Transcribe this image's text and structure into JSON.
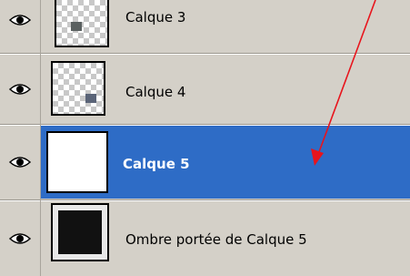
{
  "layers": [
    {
      "name": "Calque 3",
      "selected": false,
      "visible": true,
      "icon": "eye-icon"
    },
    {
      "name": "Calque 4",
      "selected": false,
      "visible": true,
      "icon": "eye-icon"
    },
    {
      "name": "Calque 5",
      "selected": true,
      "visible": true,
      "icon": "eye-icon"
    },
    {
      "name": "Ombre portée de Calque 5",
      "selected": false,
      "visible": true,
      "icon": "eye-icon"
    }
  ],
  "colors": {
    "panel_bg": "#d4d0c8",
    "selected_bg": "#2e6cc6",
    "arrow": "#e8141c"
  },
  "annotation": {
    "type": "arrow",
    "color": "#e8141c"
  }
}
